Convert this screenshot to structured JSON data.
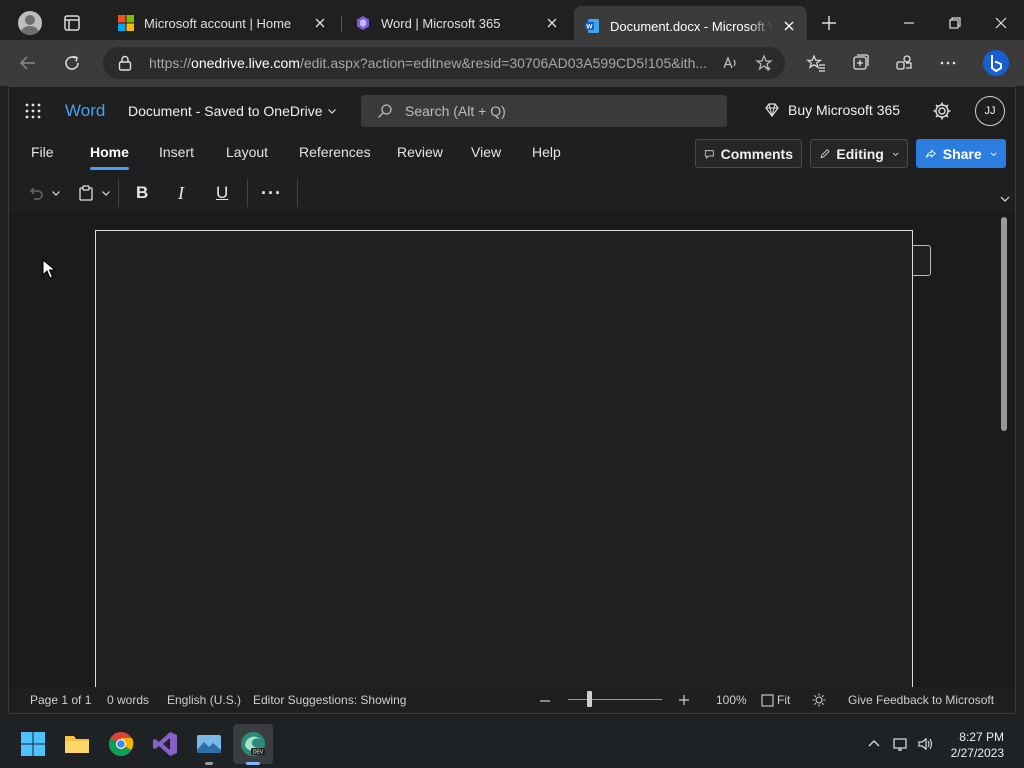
{
  "browser": {
    "tabs": [
      {
        "title": "Microsoft account | Home",
        "favicon": "microsoft-logo-icon"
      },
      {
        "title": "Word | Microsoft 365",
        "favicon": "m365-icon"
      },
      {
        "title": "Document.docx - Microsoft Word",
        "favicon": "word-icon",
        "active": true
      }
    ],
    "address": {
      "scheme": "https://",
      "host": "onedrive.live.com",
      "path": "/edit.aspx?action=editnew&resid=30706AD03A599CD5!105&ith..."
    }
  },
  "app": {
    "name": "Word",
    "document_title": "Document - Saved to OneDrive",
    "search_placeholder": "Search (Alt + Q)",
    "buy_label": "Buy Microsoft 365",
    "avatar_initials": "JJ",
    "menu_tabs": [
      "File",
      "Home",
      "Insert",
      "Layout",
      "References",
      "Review",
      "View",
      "Help"
    ],
    "active_tab": "Home",
    "comments_label": "Comments",
    "editing_label": "Editing",
    "share_label": "Share",
    "toolbar": {
      "bold": "B",
      "italic": "I",
      "underline": "U",
      "more": "···"
    }
  },
  "status_bar": {
    "page": "Page 1 of 1",
    "words": "0 words",
    "language": "English (U.S.)",
    "editor": "Editor Suggestions: Showing",
    "zoom": "100%",
    "fit": "Fit",
    "feedback": "Give Feedback to Microsoft"
  },
  "taskbar": {
    "time": "8:27 PM",
    "date": "2/27/2023",
    "apps": [
      "windows-start-icon",
      "file-explorer-icon",
      "chrome-icon",
      "visual-studio-icon",
      "photos-app-icon",
      "edge-dev-icon"
    ]
  },
  "colors": {
    "accent": "#4a9ff5",
    "share_button": "#2b7de0"
  }
}
